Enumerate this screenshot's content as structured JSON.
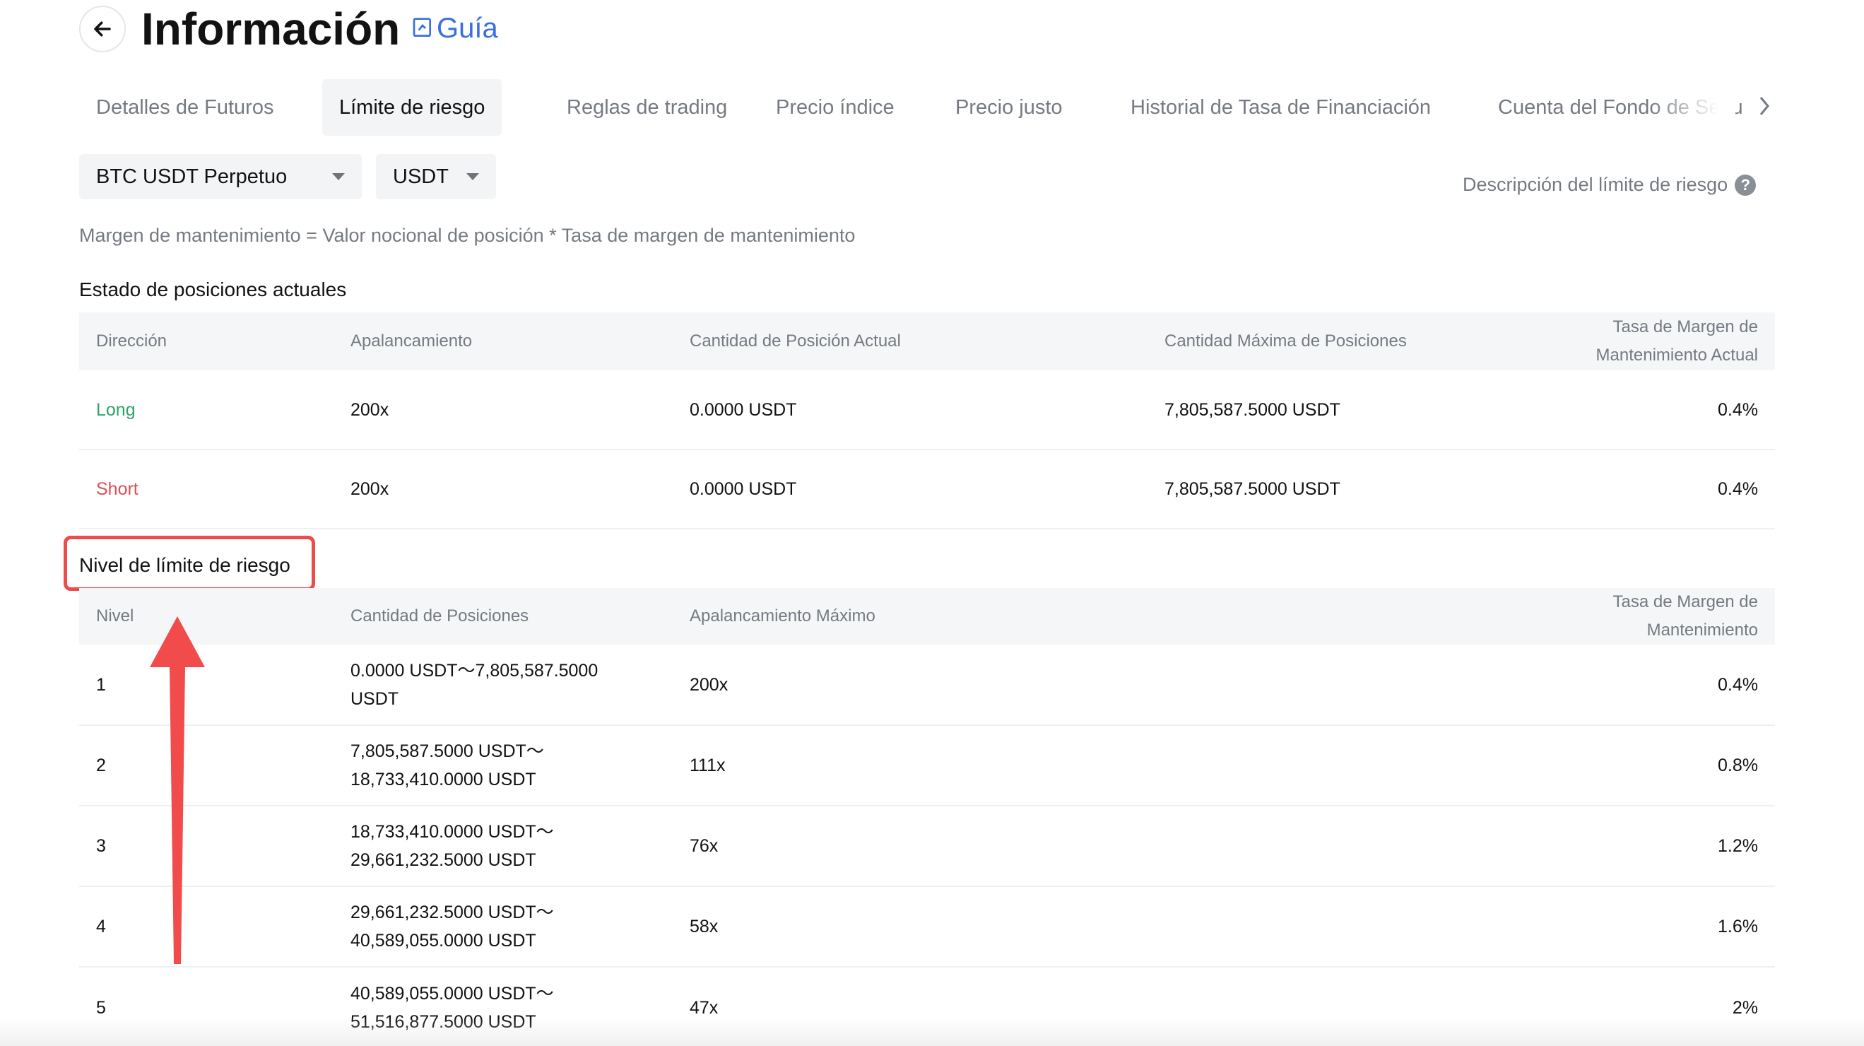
{
  "header": {
    "title": "Información",
    "guide_label": "Guía"
  },
  "tabs": [
    {
      "label": "Detalles de Futuros"
    },
    {
      "label": "Límite de riesgo",
      "active": true
    },
    {
      "label": "Reglas de trading"
    },
    {
      "label": "Precio índice"
    },
    {
      "label": "Precio justo"
    },
    {
      "label": "Historial de Tasa de Financiación"
    },
    {
      "label": "Cuenta del Fondo de Segu"
    }
  ],
  "filters": {
    "contract": "BTC USDT Perpetuo",
    "currency": "USDT"
  },
  "risk_limit_description": "Descripción del límite de riesgo",
  "formula": "Margen de mantenimiento = Valor nocional de posición * Tasa de margen de mantenimiento",
  "current_positions": {
    "title": "Estado de posiciones actuales",
    "headers": {
      "direction": "Dirección",
      "leverage": "Apalancamiento",
      "current_amount": "Cantidad de Posición Actual",
      "max_amount": "Cantidad Máxima de Posiciones",
      "mmr_line1": "Tasa de Margen de",
      "mmr_line2": "Mantenimiento Actual"
    },
    "rows": [
      {
        "direction": "Long",
        "leverage": "200x",
        "current": "0.0000 USDT",
        "max": "7,805,587.5000 USDT",
        "mmr": "0.4%"
      },
      {
        "direction": "Short",
        "leverage": "200x",
        "current": "0.0000 USDT",
        "max": "7,805,587.5000 USDT",
        "mmr": "0.4%"
      }
    ]
  },
  "risk_tiers": {
    "title": "Nivel de límite de riesgo",
    "headers": {
      "level": "Nivel",
      "amount": "Cantidad de Posiciones",
      "max_leverage": "Apalancamiento Máximo",
      "mmr": "Tasa de Margen de Mantenimiento"
    },
    "rows": [
      {
        "level": "1",
        "amount_line1": "0.0000 USDT～7,805,587.5000",
        "amount_line2": "USDT",
        "leverage": "200x",
        "mmr": "0.4%"
      },
      {
        "level": "2",
        "amount_line1": "7,805,587.5000 USDT～",
        "amount_line2": "18,733,410.0000 USDT",
        "leverage": "111x",
        "mmr": "0.8%"
      },
      {
        "level": "3",
        "amount_line1": "18,733,410.0000 USDT～",
        "amount_line2": "29,661,232.5000 USDT",
        "leverage": "76x",
        "mmr": "1.2%"
      },
      {
        "level": "4",
        "amount_line1": "29,661,232.5000 USDT～",
        "amount_line2": "40,589,055.0000 USDT",
        "leverage": "58x",
        "mmr": "1.6%"
      },
      {
        "level": "5",
        "amount_line1": "40,589,055.0000 USDT～",
        "amount_line2": "51,516,877.5000 USDT",
        "leverage": "47x",
        "mmr": "2%"
      }
    ]
  },
  "icons": {
    "back": "arrow-left-icon",
    "guide": "book-icon",
    "tabs_next": "chevron-right-icon",
    "help": "question-icon",
    "dropdown": "caret-down-icon"
  },
  "colors": {
    "long": "#2ea368",
    "short": "#e04e56",
    "link": "#3a6fe0",
    "annotation": "#ee4b4b"
  }
}
